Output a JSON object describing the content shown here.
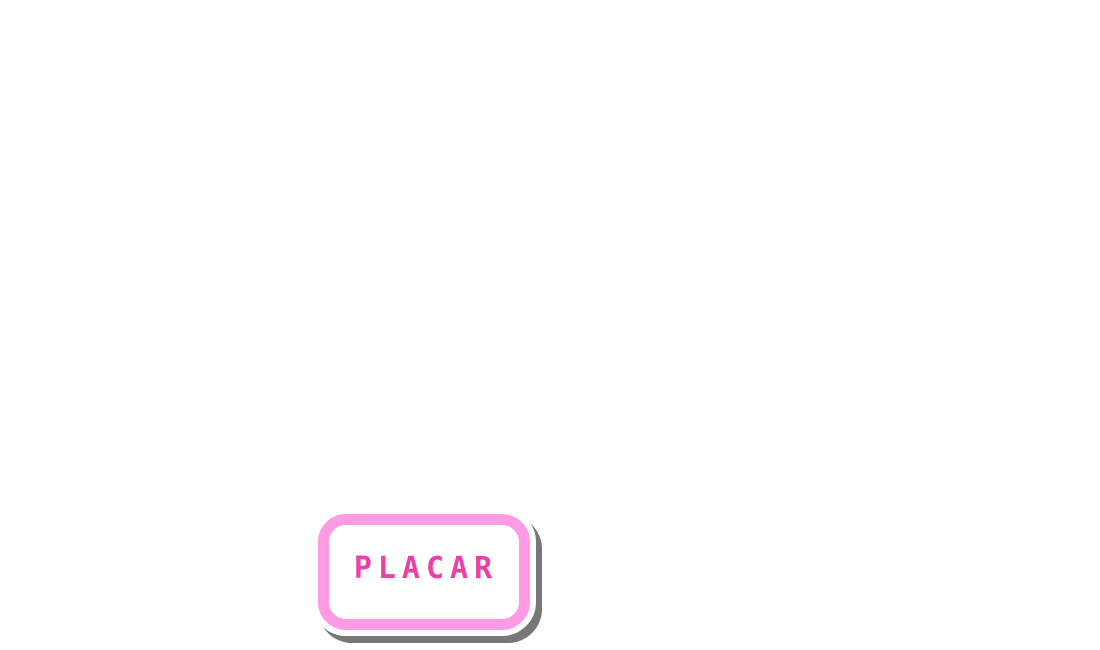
{
  "menu": {
    "placar_button_label": "PLACAR"
  },
  "colors": {
    "background": "#ffffff",
    "button_border": "#ff9ae4",
    "button_text": "#ec3fa7",
    "button_shadow": "#777777"
  }
}
